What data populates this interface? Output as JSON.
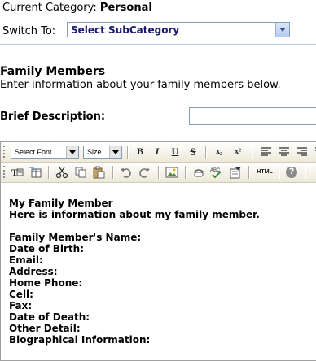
{
  "header": {
    "current_category_label": "Current Category:",
    "current_category_value": "Personal",
    "switch_label": "Switch To:",
    "subcategory_selected": "Select SubCategory"
  },
  "section": {
    "title": "Family Members",
    "description": "Enter information about your family members below."
  },
  "brief": {
    "label": "Brief Description:",
    "value": ""
  },
  "editor": {
    "font_select": "Select Font",
    "size_select": "Size",
    "toolbar": {
      "bold": "B",
      "italic": "I",
      "underline": "U",
      "strike": "S",
      "subscript": "x₂",
      "superscript": "x²",
      "html": "HTML",
      "help": "?"
    },
    "content": {
      "heading": "My Family Member",
      "intro": "Here is information about my family member.",
      "fields": [
        "Family Member's Name:",
        "Date of Birth:",
        "Email:",
        "Address:",
        "Home Phone:",
        "Cell:",
        "Fax:",
        "Date of Death:",
        "Other Detail:",
        "Biographical Information:"
      ]
    }
  }
}
